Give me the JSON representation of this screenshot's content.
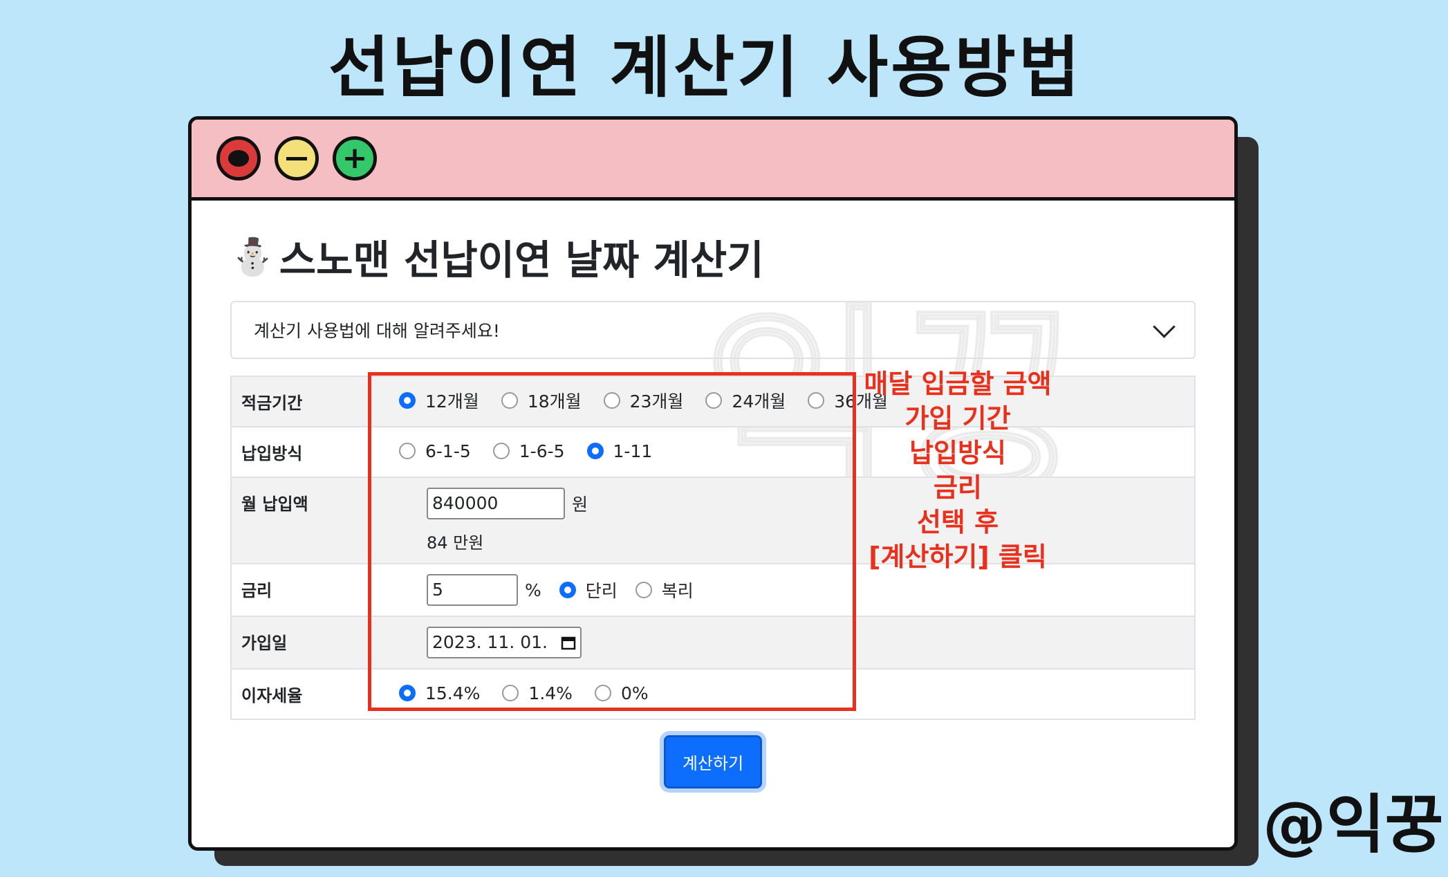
{
  "headline": "선납이연 계산기 사용방법",
  "watermark": "익꿍",
  "window": {
    "buttons": [
      "close",
      "minimize",
      "maximize"
    ]
  },
  "page": {
    "icon": "⛄",
    "title": "스노맨 선납이연 날짜 계산기",
    "accordion_label": "계산기 사용법에 대해 알려주세요!"
  },
  "form": {
    "period": {
      "label": "적금기간",
      "options": [
        "12개월",
        "18개월",
        "23개월",
        "24개월",
        "36개월"
      ],
      "selected": "12개월"
    },
    "method": {
      "label": "납입방식",
      "options": [
        "6-1-5",
        "1-6-5",
        "1-11"
      ],
      "selected": "1-11"
    },
    "monthly": {
      "label": "월 납입액",
      "value": "840000",
      "unit": "원",
      "hint": "84 만원"
    },
    "rate": {
      "label": "금리",
      "value": "5",
      "unit": "%",
      "options": [
        "단리",
        "복리"
      ],
      "selected": "단리"
    },
    "join_date": {
      "label": "가입일",
      "value": "2023. 11. 01."
    },
    "tax": {
      "label": "이자세율",
      "options": [
        "15.4%",
        "1.4%",
        "0%"
      ],
      "selected": "15.4%"
    },
    "submit_label": "계산하기"
  },
  "annotation": [
    "매달 입금할 금액",
    "가입 기간",
    "납입방식",
    "금리",
    "선택 후",
    "[계산하기] 클릭"
  ],
  "handle": "@익꿍",
  "colors": {
    "background": "#bde6fb",
    "titlebar": "#f4bec3",
    "accent": "#0d6efd",
    "annotation": "#e8301c"
  }
}
